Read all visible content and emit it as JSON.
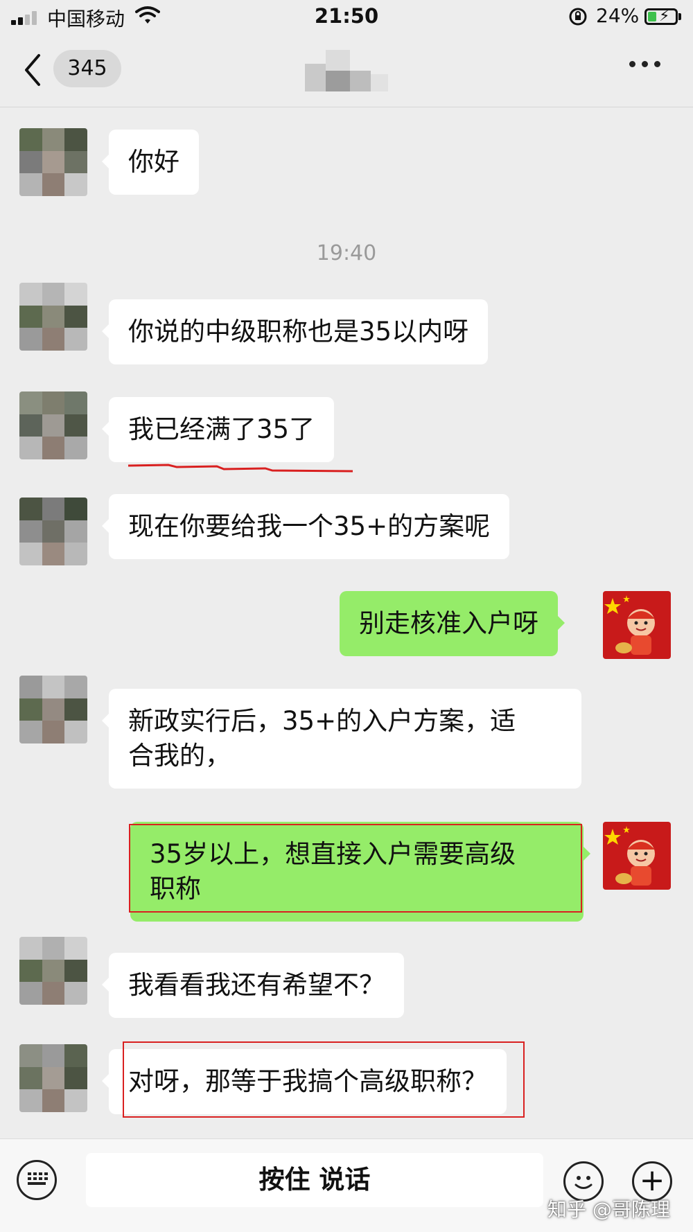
{
  "status_bar": {
    "carrier": "中国移动",
    "time": "21:50",
    "battery": "24%"
  },
  "nav": {
    "unread_count": "345"
  },
  "messages": [
    {
      "id": "m1",
      "side": "in",
      "text": "你好"
    },
    {
      "id": "m2",
      "side": "in",
      "text": "你说的中级职称也是35以内呀"
    },
    {
      "id": "m3",
      "side": "in",
      "text": "我已经满了35了"
    },
    {
      "id": "m4",
      "side": "in",
      "text": "现在你要给我一个35+的方案呢"
    },
    {
      "id": "m5",
      "side": "out",
      "text": "别走核准入户呀"
    },
    {
      "id": "m6",
      "side": "in",
      "text": "新政实行后，35+的入户方案，适\n合我的，"
    },
    {
      "id": "m7",
      "side": "out",
      "text": "35岁以上，想直接入户需要高级\n职称"
    },
    {
      "id": "m8",
      "side": "in",
      "text": "我看看我还有希望不？"
    },
    {
      "id": "m9",
      "side": "in",
      "text": "对呀，那等于我搞个高级职称？"
    }
  ],
  "timestamp": "19:40",
  "bottom_bar": {
    "hold_to_talk": "按住 说话"
  },
  "watermark": "知乎 @哥陈理",
  "colors": {
    "background": "#ededed",
    "bubble_incoming": "#ffffff",
    "bubble_outgoing": "#95ec69",
    "highlight_red": "#d92020"
  },
  "icons": {
    "back": "chevron-left-icon",
    "more": "more-dots-icon",
    "keyboard": "keyboard-icon",
    "emoji": "emoji-icon",
    "plus": "plus-icon"
  }
}
